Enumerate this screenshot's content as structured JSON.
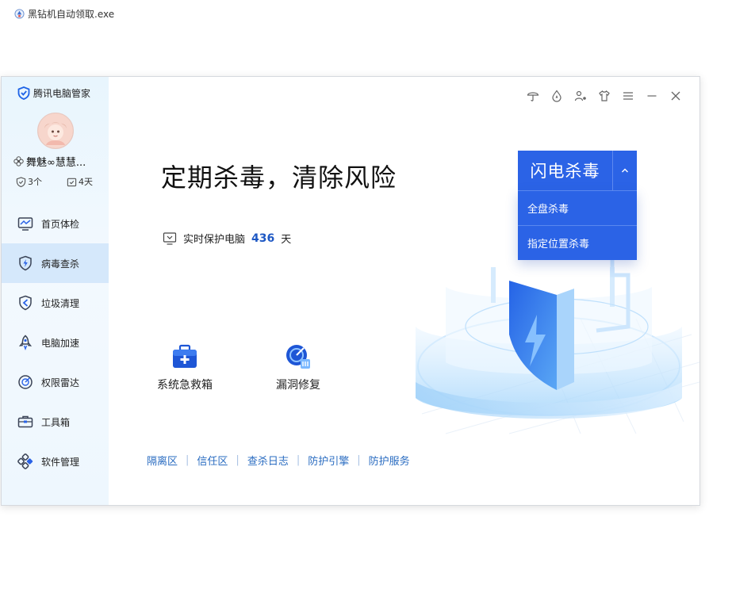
{
  "exe_title": "黑钻机自动领取.exe",
  "app": {
    "brand": "腾讯电脑管家",
    "username": "舞魅∞慧慧...",
    "stats": [
      {
        "icon": "shield-check-icon",
        "value": "3个"
      },
      {
        "icon": "calendar-check-icon",
        "value": "4天"
      }
    ]
  },
  "sidebar": {
    "items": [
      {
        "label": "首页体检",
        "icon": "monitor-chart-icon",
        "active": false
      },
      {
        "label": "病毒查杀",
        "icon": "lightning-shield-icon",
        "active": true
      },
      {
        "label": "垃圾清理",
        "icon": "cleanup-icon",
        "active": false
      },
      {
        "label": "电脑加速",
        "icon": "rocket-icon",
        "active": false
      },
      {
        "label": "权限雷达",
        "icon": "radar-icon",
        "active": false
      },
      {
        "label": "工具箱",
        "icon": "toolbox-icon",
        "active": false
      },
      {
        "label": "软件管理",
        "icon": "apps-icon",
        "active": false
      }
    ]
  },
  "window_controls": [
    "umbrella-icon",
    "drop-icon",
    "user-settings-icon",
    "shirt-icon",
    "menu-icon",
    "minimize-icon",
    "close-icon"
  ],
  "main": {
    "headline": "定期杀毒，清除风险",
    "protect_label": "实时保护电脑",
    "protect_days": "436",
    "protect_unit": "天",
    "scan_button": "闪电杀毒",
    "dropdown": [
      "全盘杀毒",
      "指定位置杀毒"
    ],
    "tools": [
      {
        "label": "系统急救箱",
        "icon": "first-aid-kit-icon"
      },
      {
        "label": "漏洞修复",
        "icon": "vulnerability-fix-icon"
      }
    ],
    "links": [
      "隔离区",
      "信任区",
      "查杀日志",
      "防护引擎",
      "防护服务"
    ]
  },
  "colors": {
    "accent": "#2b63e6",
    "link": "#2a6cc1",
    "sidebar_active": "#d5e8fb",
    "days": "#1e58c4"
  }
}
